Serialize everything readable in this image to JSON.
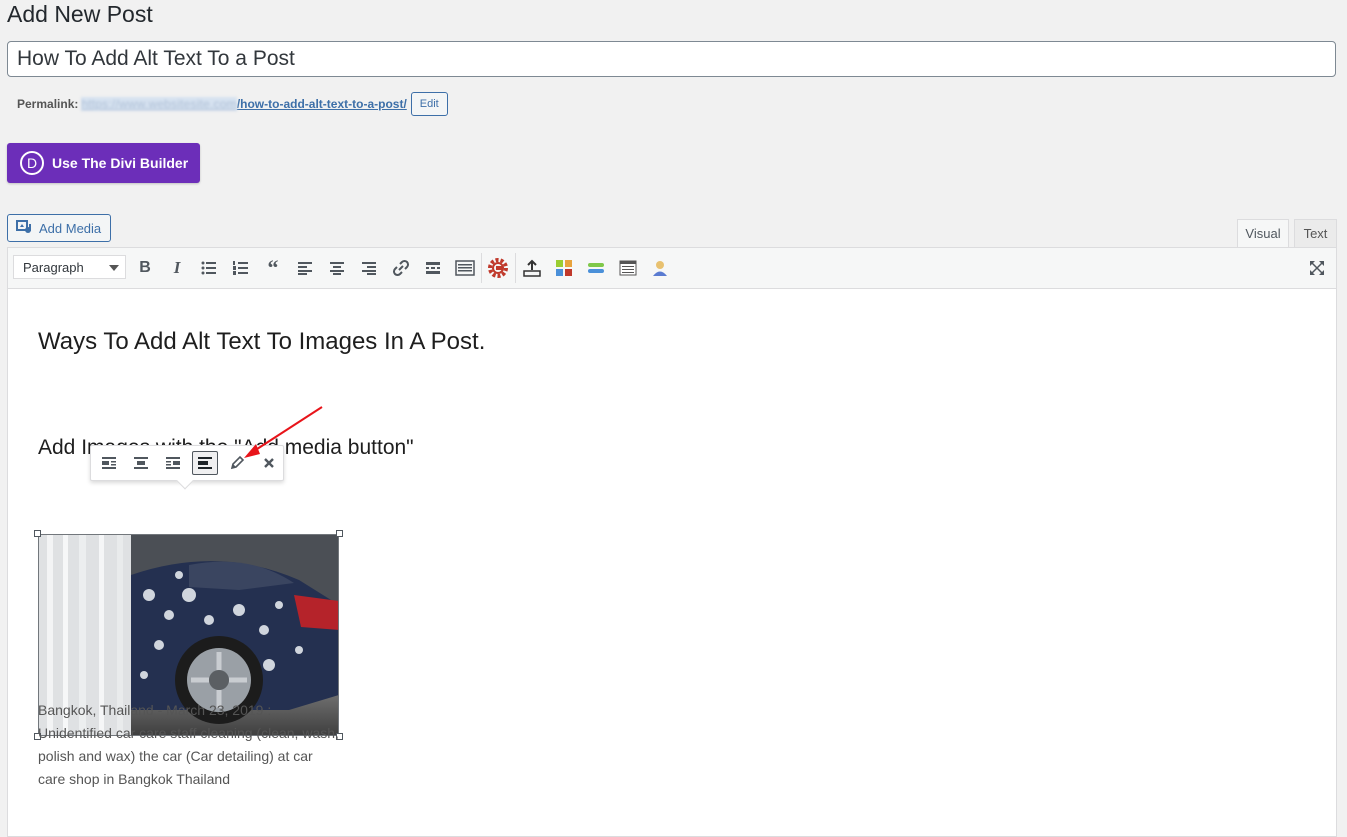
{
  "page": {
    "title": "Add New Post"
  },
  "post": {
    "title_value": "How To Add Alt Text To a Post"
  },
  "permalink": {
    "label": "Permalink:",
    "domain_blurred": "https://www.websitesite.com",
    "slug": "/how-to-add-alt-text-to-a-post/",
    "edit_label": "Edit"
  },
  "divi": {
    "logo_letter": "D",
    "label": "Use The Divi Builder",
    "color": "#6c2eb9"
  },
  "media": {
    "add_media_label": "Add Media",
    "icon": "media-icon"
  },
  "tabs": {
    "visual": "Visual",
    "text": "Text"
  },
  "toolbar": {
    "format_value": "Paragraph",
    "buttons": [
      "bold",
      "italic",
      "bulleted-list",
      "numbered-list",
      "blockquote",
      "align-left",
      "align-center",
      "align-right",
      "link",
      "read-more",
      "toolbar-toggle",
      "plugin-gear",
      "upload",
      "colors",
      "divider",
      "table",
      "user",
      "fullscreen"
    ]
  },
  "content": {
    "heading1": "Ways To Add Alt Text To Images In A Post.",
    "heading2": "Add Images with the \"Add media button\"",
    "image_caption": "Bangkok, Thailand - March 23, 2019 : Unidentified car care staff cleaning (clean, wash, polish and wax) the car (Car detailing) at car care shop in Bangkok Thailand"
  },
  "image_toolbar": {
    "buttons": [
      "align-left-icon",
      "align-center-icon",
      "align-right-icon",
      "align-none-icon",
      "edit-pencil-icon",
      "remove-icon"
    ],
    "active": "align-none-icon"
  },
  "annotation": {
    "arrow_color": "#e8141a"
  }
}
